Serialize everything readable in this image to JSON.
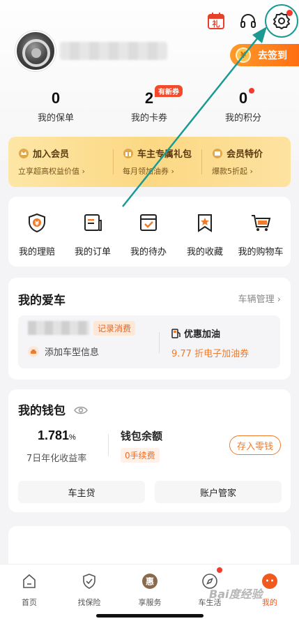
{
  "header": {
    "signin_label": "去签到",
    "signin_coin": "¥",
    "calendar_glyph": "礼"
  },
  "stats": [
    {
      "value": "0",
      "label": "我的保单"
    },
    {
      "value": "2",
      "label": "我的卡券"
    },
    {
      "value": "0",
      "label": "我的积分"
    }
  ],
  "stats_badge": "有新券",
  "member": [
    {
      "title": "加入会员",
      "sub": "立享超高权益价值 ›"
    },
    {
      "title": "车主专属礼包",
      "sub": "每月领加油券 ›"
    },
    {
      "title": "会员特价",
      "sub": "爆款5折起 ›"
    }
  ],
  "quick": [
    {
      "label": "我的理赔"
    },
    {
      "label": "我的订单"
    },
    {
      "label": "我的待办"
    },
    {
      "label": "我的收藏"
    },
    {
      "label": "我的购物车"
    }
  ],
  "car": {
    "title": "我的爱车",
    "manage": "车辆管理",
    "record_tag": "记录消费",
    "add_model": "添加车型信息",
    "fuel_title": "优惠加油",
    "fuel_sub": "9.77 折电子加油券"
  },
  "wallet": {
    "title": "我的钱包",
    "rate": "1.781",
    "rate_unit": "%",
    "rate_label": "7日年化收益率",
    "balance_label": "钱包余额",
    "fee_tag": "0手续费",
    "deposit": "存入零钱",
    "btn_loan": "车主贷",
    "btn_account": "账户管家"
  },
  "tabs": [
    {
      "label": "首页"
    },
    {
      "label": "找保险"
    },
    {
      "label": "享服务",
      "icon_text": "惠"
    },
    {
      "label": "车生活"
    },
    {
      "label": "我的"
    }
  ],
  "watermark": "Bai度经验",
  "colors": {
    "accent": "#f07b2a",
    "annotation": "#1a9a93",
    "badge_red": "#f23a2d"
  }
}
